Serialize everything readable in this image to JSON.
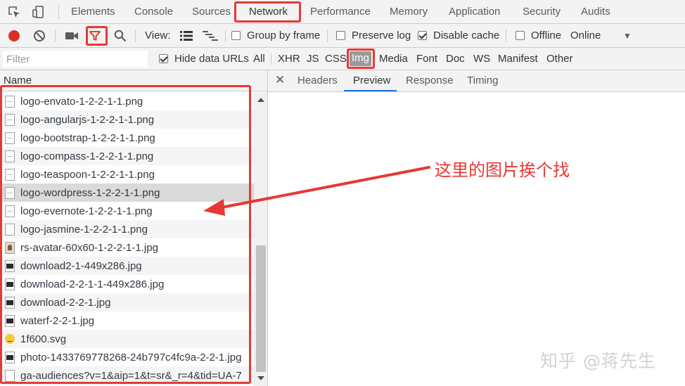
{
  "panel_tabs": [
    "Elements",
    "Console",
    "Sources",
    "Network",
    "Performance",
    "Memory",
    "Application",
    "Security",
    "Audits"
  ],
  "active_panel": "Network",
  "toolbar": {
    "view_label": "View:",
    "group_by_frame": "Group by frame",
    "preserve_log": "Preserve log",
    "disable_cache": "Disable cache",
    "offline": "Offline",
    "online": "Online",
    "checked": {
      "group_by_frame": false,
      "preserve_log": false,
      "disable_cache": true,
      "offline": false
    }
  },
  "filter": {
    "placeholder": "Filter",
    "hide_data_urls": "Hide data URLs",
    "hide_data_urls_checked": true,
    "types": [
      "All",
      "XHR",
      "JS",
      "CSS",
      "Img",
      "Media",
      "Font",
      "Doc",
      "WS",
      "Manifest",
      "Other"
    ],
    "selected_type": "Img"
  },
  "name_column": {
    "header": "Name",
    "rows": [
      {
        "name": "logo-envato-1-2-2-1-1.png",
        "icon": "file-icon"
      },
      {
        "name": "logo-angularjs-1-2-2-1-1.png",
        "icon": "file-icon"
      },
      {
        "name": "logo-bootstrap-1-2-2-1-1.png",
        "icon": "file-icon"
      },
      {
        "name": "logo-compass-1-2-2-1-1.png",
        "icon": "file-icon"
      },
      {
        "name": "logo-teaspoon-1-2-2-1-1.png",
        "icon": "file-icon"
      },
      {
        "name": "logo-wordpress-1-2-2-1-1.png",
        "icon": "file-icon"
      },
      {
        "name": "logo-evernote-1-2-2-1-1.png",
        "icon": "file-icon"
      },
      {
        "name": "logo-jasmine-1-2-2-1-1.png",
        "icon": "file-icon"
      },
      {
        "name": "rs-avatar-60x60-1-2-2-1-1.jpg",
        "icon": "avatar-thumbnail-icon"
      },
      {
        "name": "download2-1-449x286.jpg",
        "icon": "image-thumbnail-icon"
      },
      {
        "name": "download-2-2-1-1-449x286.jpg",
        "icon": "image-thumbnail-icon"
      },
      {
        "name": "download-2-2-1.jpg",
        "icon": "image-thumbnail-icon"
      },
      {
        "name": "waterf-2-2-1.jpg",
        "icon": "image-thumbnail-icon"
      },
      {
        "name": "1f600.svg",
        "icon": "emoji-thumbnail-icon"
      },
      {
        "name": "photo-1433769778268-24b797c4fc9a-2-2-1.jpg",
        "icon": "image-thumbnail-icon"
      },
      {
        "name": "ga-audiences?v=1&aip=1&t=sr&_r=4&tid=UA-7",
        "icon": "file-icon"
      }
    ],
    "selected_row": "logo-wordpress-1-2-2-1-1.png"
  },
  "detail": {
    "tabs": [
      "Headers",
      "Preview",
      "Response",
      "Timing"
    ],
    "active_tab": "Preview"
  },
  "annotation": {
    "text": "这里的图片挨个找"
  },
  "watermark": "知乎 @蒋先生",
  "colors": {
    "highlight_red": "#e53935",
    "record_red": "#d93025",
    "active_tab_blue": "#1a73e8"
  }
}
